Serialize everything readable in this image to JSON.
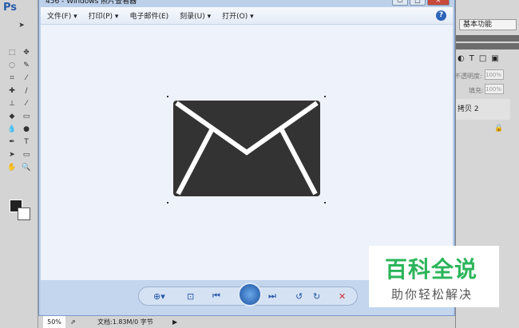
{
  "ps": {
    "logo": "Ps",
    "workspace": "基本功能",
    "opacity_label": "不透明度:",
    "opacity_value": "100%",
    "fill_label": "填充:",
    "fill_value": "100%",
    "layer_name": "拷贝 2",
    "zoom": "50%",
    "doc_info": "文档:1.83M/0 字节"
  },
  "viewer": {
    "title": "456 - Windows 照片查看器",
    "menu": [
      "文件(F)",
      "打印(P)",
      "电子邮件(E)",
      "刻录(U)",
      "打开(O)"
    ],
    "help": "?"
  },
  "watermark": {
    "line1": "百科全说",
    "line2": "助你轻松解决"
  }
}
